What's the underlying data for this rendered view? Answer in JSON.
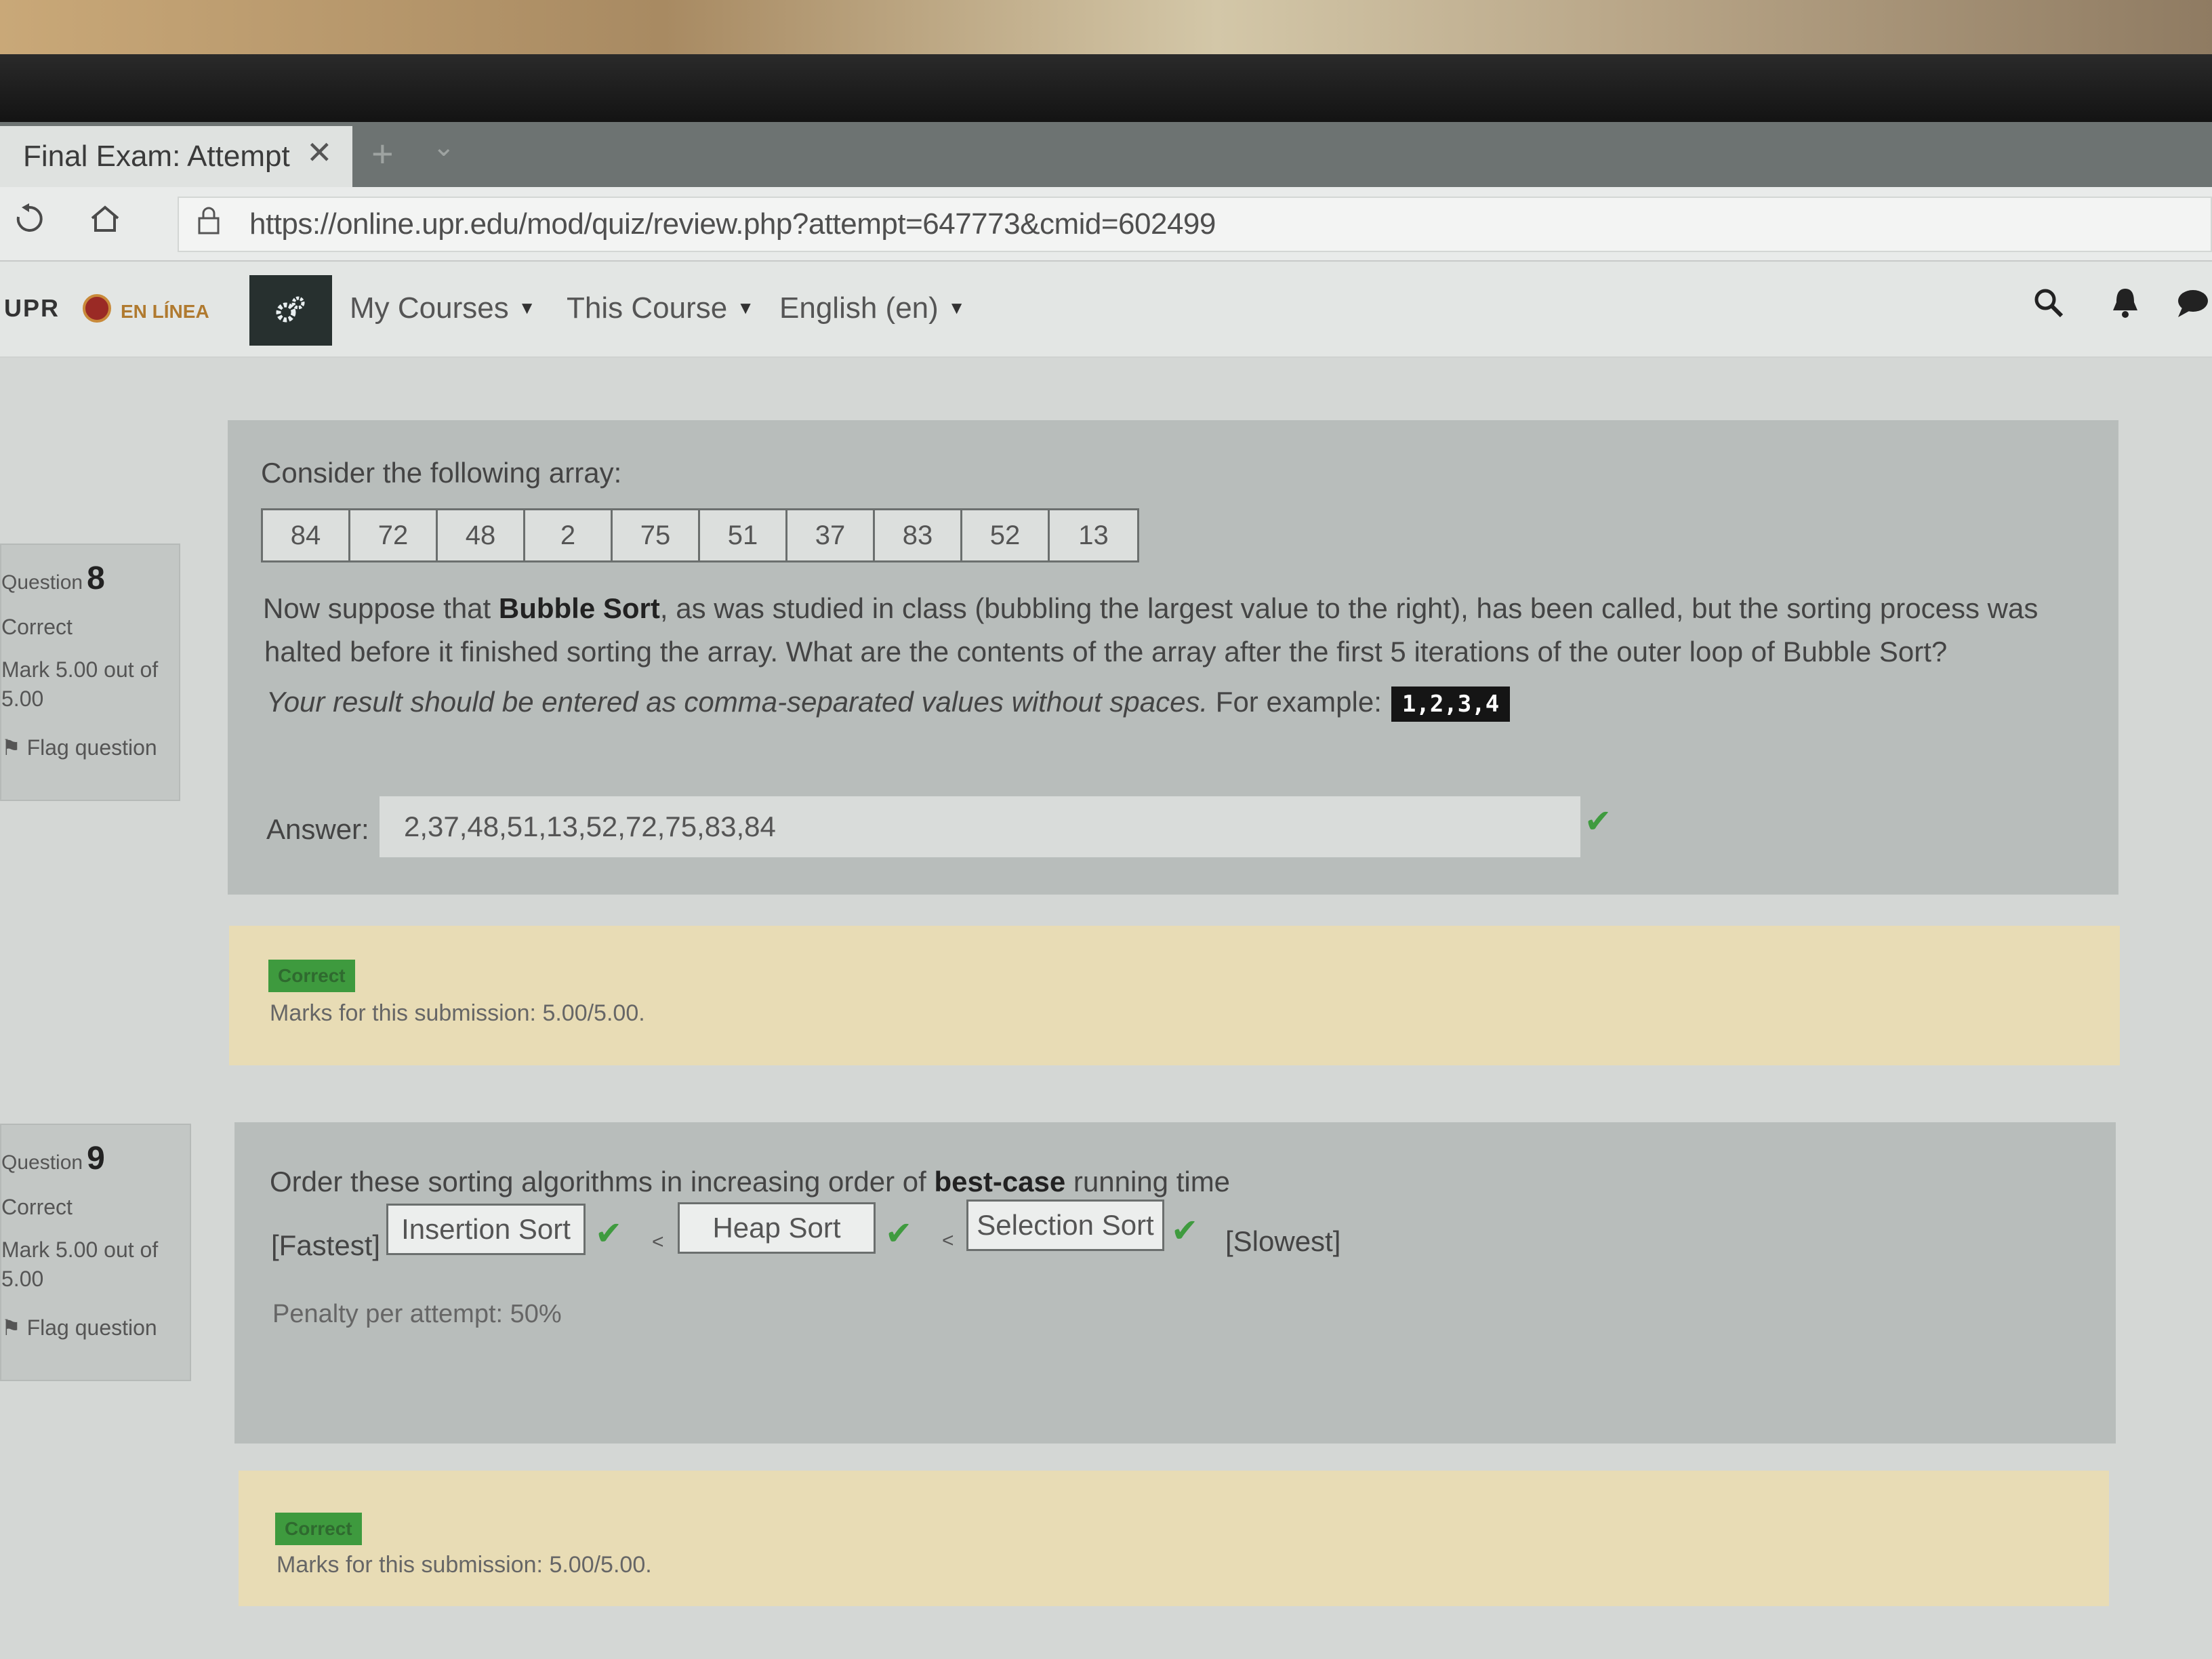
{
  "browser": {
    "tab_title": "Final Exam: Attempt",
    "close_glyph": "✕",
    "new_tab_glyph": "+",
    "tab_list_glyph": "⌄",
    "url": "https://online.upr.edu/mod/quiz/review.php?attempt=647773&cmid=602499",
    "icons": [
      "reload-icon",
      "home-icon",
      "lock-icon"
    ]
  },
  "topnav": {
    "logo_text": "UPR",
    "logo_sub": "EN LÍNEA",
    "menus": [
      "My Courses",
      "This Course",
      "English (en)"
    ],
    "icons": [
      "gear-icon",
      "search-icon",
      "bell-icon",
      "chat-icon"
    ]
  },
  "questions": [
    {
      "label": "Question",
      "number": "8",
      "status": "Correct",
      "mark_line1": "Mark 5.00 out of",
      "mark_line2": "5.00",
      "flag": "Flag question",
      "intro": "Consider the following array:",
      "array": [
        "84",
        "72",
        "48",
        "2",
        "75",
        "51",
        "37",
        "83",
        "52",
        "13"
      ],
      "text_a": "Now suppose that ",
      "text_bold": "Bubble Sort",
      "text_b": ", as was studied in class (bubbling the largest value to the right), has been called, but the sorting process was",
      "text_c": "halted before it finished sorting the array. What are the contents of the array after the first 5 iterations of the outer loop of Bubble Sort?",
      "instruction": "Your result should be entered as comma-separated values without spaces.",
      "example_label": "For example:",
      "example_code": "1,2,3,4",
      "answer_label": "Answer:",
      "answer_value": "2,37,48,51,13,52,72,75,83,84",
      "feedback_badge": "Correct",
      "feedback_marks": "Marks for this submission: 5.00/5.00."
    },
    {
      "label": "Question",
      "number": "9",
      "status": "Correct",
      "mark_line1": "Mark 5.00 out of",
      "mark_line2": "5.00",
      "flag": "Flag question",
      "prompt_a": "Order these sorting algorithms in increasing order of ",
      "prompt_bold": "best-case",
      "prompt_b": " running time",
      "fastest": "[Fastest]",
      "slowest": "[Slowest]",
      "choices": [
        "Insertion Sort",
        "Heap Sort",
        "Selection Sort"
      ],
      "separator": "<",
      "penalty": "Penalty per attempt: 50%",
      "feedback_badge": "Correct",
      "feedback_marks": "Marks for this submission: 5.00/5.00."
    }
  ],
  "colors": {
    "check": "#3f9b3f",
    "badge": "#3e9a3e",
    "feedback_bg": "#e8dcb5",
    "panel_bg": "#b8bdbb",
    "nav_button": "#27302f"
  }
}
